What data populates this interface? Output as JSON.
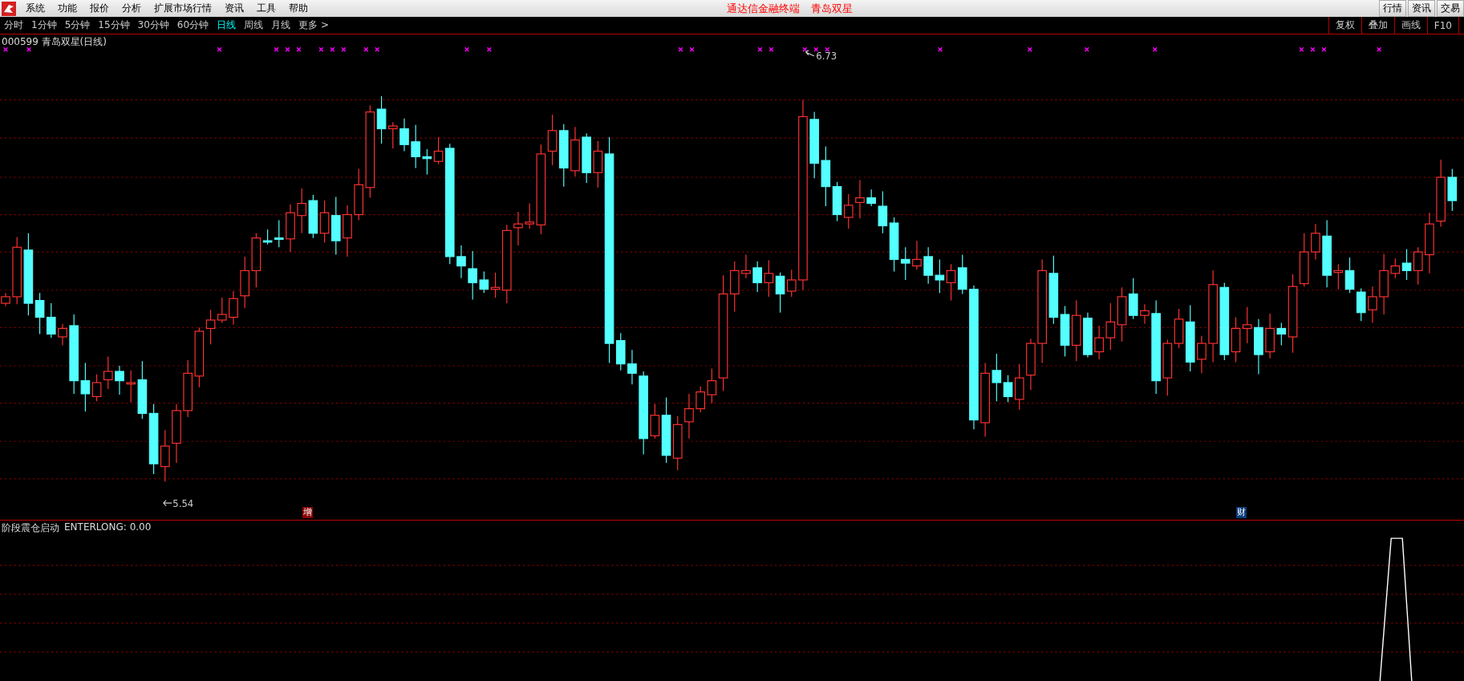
{
  "menu": [
    {
      "label": "系统"
    },
    {
      "label": "功能"
    },
    {
      "label": "报价"
    },
    {
      "label": "分析"
    },
    {
      "label": "扩展市场行情"
    },
    {
      "label": "资讯"
    },
    {
      "label": "工具"
    },
    {
      "label": "帮助"
    }
  ],
  "window": {
    "title": "通达信金融终端",
    "subtitle": "青岛双星"
  },
  "top_buttons": [
    "行情",
    "资讯",
    "交易"
  ],
  "periods": [
    {
      "label": "分时",
      "selected": false
    },
    {
      "label": "1分钟",
      "selected": false
    },
    {
      "label": "5分钟",
      "selected": false
    },
    {
      "label": "15分钟",
      "selected": false
    },
    {
      "label": "30分钟",
      "selected": false
    },
    {
      "label": "60分钟",
      "selected": false
    },
    {
      "label": "日线",
      "selected": true
    },
    {
      "label": "周线",
      "selected": false
    },
    {
      "label": "月线",
      "selected": false
    },
    {
      "label": "更多 >",
      "selected": false
    }
  ],
  "tools": [
    "复权",
    "叠加",
    "画线",
    "F10"
  ],
  "chart": {
    "title": "000599 青岛双星(日线)",
    "high_label": "6.73",
    "low_label": "5.54",
    "markers": [
      {
        "label": "增",
        "color": "#8b0000"
      },
      {
        "label": "财",
        "color": "#0a3a78"
      }
    ]
  },
  "indicator": {
    "name": "阶段震仓启动",
    "value": "ENTERLONG: 0.00"
  }
}
